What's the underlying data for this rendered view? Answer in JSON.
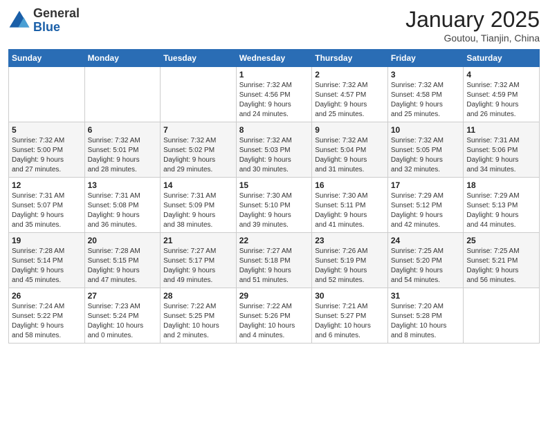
{
  "logo": {
    "general": "General",
    "blue": "Blue"
  },
  "title": "January 2025",
  "location": "Goutou, Tianjin, China",
  "weekdays": [
    "Sunday",
    "Monday",
    "Tuesday",
    "Wednesday",
    "Thursday",
    "Friday",
    "Saturday"
  ],
  "weeks": [
    [
      {
        "day": "",
        "info": ""
      },
      {
        "day": "",
        "info": ""
      },
      {
        "day": "",
        "info": ""
      },
      {
        "day": "1",
        "info": "Sunrise: 7:32 AM\nSunset: 4:56 PM\nDaylight: 9 hours\nand 24 minutes."
      },
      {
        "day": "2",
        "info": "Sunrise: 7:32 AM\nSunset: 4:57 PM\nDaylight: 9 hours\nand 25 minutes."
      },
      {
        "day": "3",
        "info": "Sunrise: 7:32 AM\nSunset: 4:58 PM\nDaylight: 9 hours\nand 25 minutes."
      },
      {
        "day": "4",
        "info": "Sunrise: 7:32 AM\nSunset: 4:59 PM\nDaylight: 9 hours\nand 26 minutes."
      }
    ],
    [
      {
        "day": "5",
        "info": "Sunrise: 7:32 AM\nSunset: 5:00 PM\nDaylight: 9 hours\nand 27 minutes."
      },
      {
        "day": "6",
        "info": "Sunrise: 7:32 AM\nSunset: 5:01 PM\nDaylight: 9 hours\nand 28 minutes."
      },
      {
        "day": "7",
        "info": "Sunrise: 7:32 AM\nSunset: 5:02 PM\nDaylight: 9 hours\nand 29 minutes."
      },
      {
        "day": "8",
        "info": "Sunrise: 7:32 AM\nSunset: 5:03 PM\nDaylight: 9 hours\nand 30 minutes."
      },
      {
        "day": "9",
        "info": "Sunrise: 7:32 AM\nSunset: 5:04 PM\nDaylight: 9 hours\nand 31 minutes."
      },
      {
        "day": "10",
        "info": "Sunrise: 7:32 AM\nSunset: 5:05 PM\nDaylight: 9 hours\nand 32 minutes."
      },
      {
        "day": "11",
        "info": "Sunrise: 7:31 AM\nSunset: 5:06 PM\nDaylight: 9 hours\nand 34 minutes."
      }
    ],
    [
      {
        "day": "12",
        "info": "Sunrise: 7:31 AM\nSunset: 5:07 PM\nDaylight: 9 hours\nand 35 minutes."
      },
      {
        "day": "13",
        "info": "Sunrise: 7:31 AM\nSunset: 5:08 PM\nDaylight: 9 hours\nand 36 minutes."
      },
      {
        "day": "14",
        "info": "Sunrise: 7:31 AM\nSunset: 5:09 PM\nDaylight: 9 hours\nand 38 minutes."
      },
      {
        "day": "15",
        "info": "Sunrise: 7:30 AM\nSunset: 5:10 PM\nDaylight: 9 hours\nand 39 minutes."
      },
      {
        "day": "16",
        "info": "Sunrise: 7:30 AM\nSunset: 5:11 PM\nDaylight: 9 hours\nand 41 minutes."
      },
      {
        "day": "17",
        "info": "Sunrise: 7:29 AM\nSunset: 5:12 PM\nDaylight: 9 hours\nand 42 minutes."
      },
      {
        "day": "18",
        "info": "Sunrise: 7:29 AM\nSunset: 5:13 PM\nDaylight: 9 hours\nand 44 minutes."
      }
    ],
    [
      {
        "day": "19",
        "info": "Sunrise: 7:28 AM\nSunset: 5:14 PM\nDaylight: 9 hours\nand 45 minutes."
      },
      {
        "day": "20",
        "info": "Sunrise: 7:28 AM\nSunset: 5:15 PM\nDaylight: 9 hours\nand 47 minutes."
      },
      {
        "day": "21",
        "info": "Sunrise: 7:27 AM\nSunset: 5:17 PM\nDaylight: 9 hours\nand 49 minutes."
      },
      {
        "day": "22",
        "info": "Sunrise: 7:27 AM\nSunset: 5:18 PM\nDaylight: 9 hours\nand 51 minutes."
      },
      {
        "day": "23",
        "info": "Sunrise: 7:26 AM\nSunset: 5:19 PM\nDaylight: 9 hours\nand 52 minutes."
      },
      {
        "day": "24",
        "info": "Sunrise: 7:25 AM\nSunset: 5:20 PM\nDaylight: 9 hours\nand 54 minutes."
      },
      {
        "day": "25",
        "info": "Sunrise: 7:25 AM\nSunset: 5:21 PM\nDaylight: 9 hours\nand 56 minutes."
      }
    ],
    [
      {
        "day": "26",
        "info": "Sunrise: 7:24 AM\nSunset: 5:22 PM\nDaylight: 9 hours\nand 58 minutes."
      },
      {
        "day": "27",
        "info": "Sunrise: 7:23 AM\nSunset: 5:24 PM\nDaylight: 10 hours\nand 0 minutes."
      },
      {
        "day": "28",
        "info": "Sunrise: 7:22 AM\nSunset: 5:25 PM\nDaylight: 10 hours\nand 2 minutes."
      },
      {
        "day": "29",
        "info": "Sunrise: 7:22 AM\nSunset: 5:26 PM\nDaylight: 10 hours\nand 4 minutes."
      },
      {
        "day": "30",
        "info": "Sunrise: 7:21 AM\nSunset: 5:27 PM\nDaylight: 10 hours\nand 6 minutes."
      },
      {
        "day": "31",
        "info": "Sunrise: 7:20 AM\nSunset: 5:28 PM\nDaylight: 10 hours\nand 8 minutes."
      },
      {
        "day": "",
        "info": ""
      }
    ]
  ]
}
